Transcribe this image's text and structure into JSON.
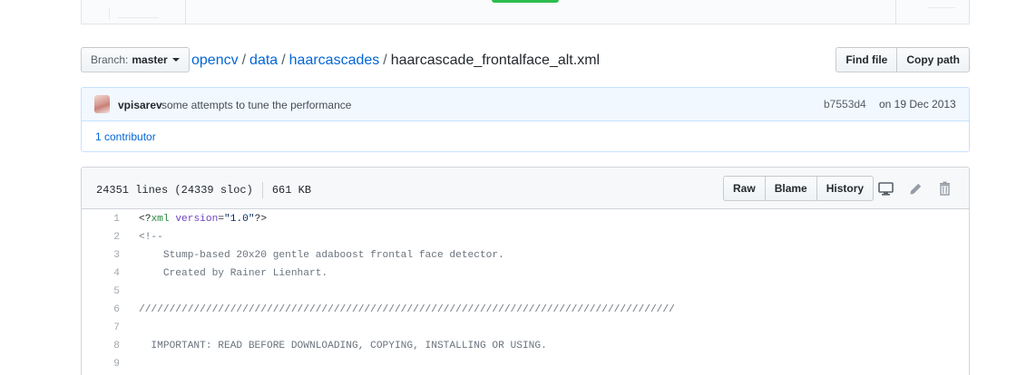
{
  "branch": {
    "label": "Branch:",
    "value": "master"
  },
  "breadcrumb": {
    "repo": "opencv",
    "dir1": "data",
    "dir2": "haarcascades",
    "file": "haarcascade_frontalface_alt.xml",
    "separator": "/"
  },
  "file_nav_buttons": {
    "find_file": "Find file",
    "copy_path": "Copy path"
  },
  "commit": {
    "author": "vpisarev",
    "message": "some attempts to tune the performance",
    "sha": "b7553d4",
    "date": "on 19 Dec 2013"
  },
  "contributors": {
    "text": "1 contributor"
  },
  "file": {
    "lines_info": "24351 lines (24339 sloc)",
    "size": "661 KB",
    "actions": {
      "raw": "Raw",
      "blame": "Blame",
      "history": "History"
    },
    "icons": [
      "desktop-icon",
      "pencil-icon",
      "trash-icon"
    ]
  },
  "code": {
    "l1": {
      "num": "1",
      "tag_open": "<?",
      "tag_name": "xml",
      "attr": "version",
      "eq": "=",
      "str": "\"1.0\"",
      "tag_close": "?>"
    },
    "l2": {
      "num": "2",
      "text": "<!--"
    },
    "l3": {
      "num": "3",
      "text": "    Stump-based 20x20 gentle adaboost frontal face detector."
    },
    "l4": {
      "num": "4",
      "text": "    Created by Rainer Lienhart."
    },
    "l5": {
      "num": "5",
      "text": ""
    },
    "l6": {
      "num": "6",
      "text": "////////////////////////////////////////////////////////////////////////////////////////"
    },
    "l7": {
      "num": "7",
      "text": ""
    },
    "l8": {
      "num": "8",
      "text": "  IMPORTANT: READ BEFORE DOWNLOADING, COPYING, INSTALLING OR USING."
    },
    "l9": {
      "num": "9",
      "text": ""
    }
  },
  "colors": {
    "link": "#0366d6",
    "commit_bg": "#f1f8ff",
    "commit_border": "#c8e1ff",
    "header_bg": "#f6f8fa",
    "comment": "#6a737d",
    "tag": "#22863a",
    "attr": "#6f42c1",
    "string": "#032f62"
  }
}
